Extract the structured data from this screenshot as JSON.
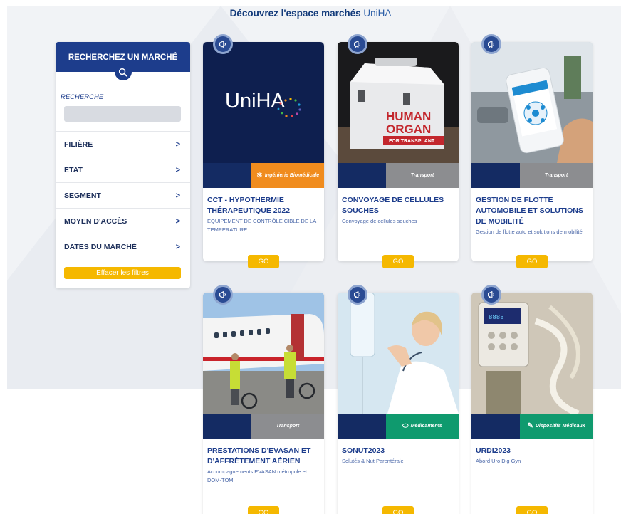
{
  "page": {
    "heading_strong": "Découvrez l'espace marchés",
    "heading_light": "UniHA"
  },
  "sidebar": {
    "title": "RECHERCHEZ UN MARCHÉ",
    "search_label": "RECHERCHE",
    "search_value": "",
    "filters": [
      {
        "label": "FILIÈRE",
        "chevron": ">"
      },
      {
        "label": "ETAT",
        "chevron": ">"
      },
      {
        "label": "SEGMENT",
        "chevron": ">"
      },
      {
        "label": "MOYEN D'ACCÈS",
        "chevron": ">"
      },
      {
        "label": "DATES DU MARCHÉ",
        "chevron": ">"
      }
    ],
    "clear_label": "Effacer les filtres"
  },
  "cards": [
    {
      "title": "CCT - HYPOTHERMIE THÉRAPEUTIQUE 2022",
      "desc": "EQUIPEMENT DE CONTRÔLE CIBLE DE LA TEMPERATURE",
      "tag": "Ingénierie Biomédicale",
      "tag_icon": "atom-icon",
      "go": "GO",
      "logo_text": "UniHA"
    },
    {
      "title": "CONVOYAGE DE CELLULES SOUCHES",
      "desc": "Convoyage de cellules souches",
      "tag": "Transport",
      "go": "GO",
      "box_text_1": "HUMAN",
      "box_text_2": "ORGAN",
      "box_text_3": "FOR TRANSPLANT"
    },
    {
      "title": "GESTION DE FLOTTE AUTOMOBILE ET SOLUTIONS DE MOBILITÉ",
      "desc": "Gestion de flotte auto et solutions de mobilité",
      "tag": "Transport",
      "go": "GO"
    },
    {
      "title": "PRESTATIONS D'EVASAN ET D'AFFRÈTEMENT AÉRIEN",
      "desc": "Accompagnements EVASAN métropole et DOM-TOM",
      "tag": "Transport",
      "go": "GO"
    },
    {
      "title": "SONUT2023",
      "desc": "Solutés & Nut Parentérale",
      "tag": "Médicaments",
      "tag_icon": "pill-icon",
      "go": "GO"
    },
    {
      "title": "URDI2023",
      "desc": "Abord Uro Dig Gyn",
      "tag": "Dispositifs Médicaux",
      "tag_icon": "syringe-icon",
      "go": "GO"
    }
  ],
  "colors": {
    "navy": "#1d3d8c",
    "yellow": "#f5b800",
    "orange": "#f08c1e",
    "grey": "#8c8d90",
    "green": "#0f9a6e"
  }
}
